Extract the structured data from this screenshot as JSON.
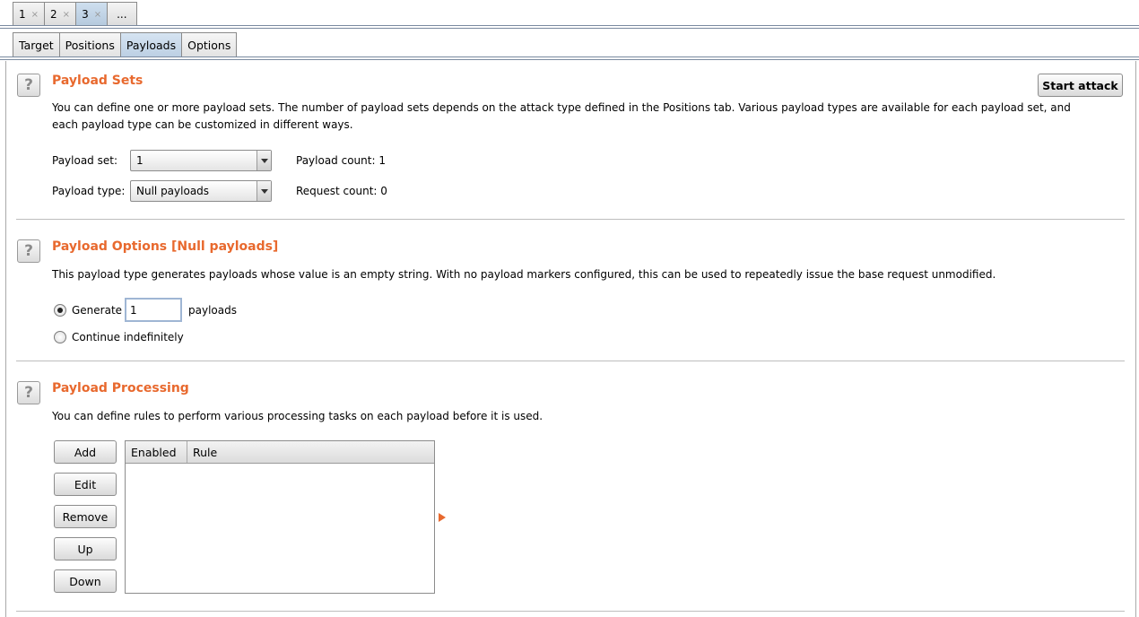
{
  "attack_tabs": [
    {
      "label": "1",
      "close": "×"
    },
    {
      "label": "2",
      "close": "×"
    },
    {
      "label": "3",
      "close": "×"
    }
  ],
  "attack_tabs_more": "...",
  "sub_tabs": [
    "Target",
    "Positions",
    "Payloads",
    "Options"
  ],
  "active_sub_tab": "Payloads",
  "start_attack_label": "Start attack",
  "help_icon": "?",
  "payload_sets": {
    "title": "Payload Sets",
    "description_line1": "You can define one or more payload sets. The number of payload sets depends on the attack type defined in the Positions tab. Various payload types are available for each payload set, and",
    "description_line2": "each payload type can be customized in different ways.",
    "set_label": "Payload set:",
    "set_value": "1",
    "type_label": "Payload type:",
    "type_value": "Null payloads",
    "payload_count_label": "Payload count:",
    "payload_count": "1",
    "request_count_label": "Request count:",
    "request_count": "0"
  },
  "payload_options": {
    "title": "Payload Options [Null payloads]",
    "description": "This payload type generates payloads whose value is an empty string. With no payload markers configured, this can be used to repeatedly issue the base request unmodified.",
    "generate_label": "Generate",
    "generate_value": "1",
    "payloads_suffix": "payloads",
    "continue_label": "Continue indefinitely",
    "selected": "generate"
  },
  "payload_processing": {
    "title": "Payload Processing",
    "description": "You can define rules to perform various processing tasks on each payload before it is used.",
    "buttons": {
      "add": "Add",
      "edit": "Edit",
      "remove": "Remove",
      "up": "Up",
      "down": "Down"
    },
    "columns": [
      "Enabled",
      "Rule"
    ],
    "rows": []
  },
  "colors": {
    "accent": "#e8692e",
    "active_tab": "#bccfe3"
  }
}
